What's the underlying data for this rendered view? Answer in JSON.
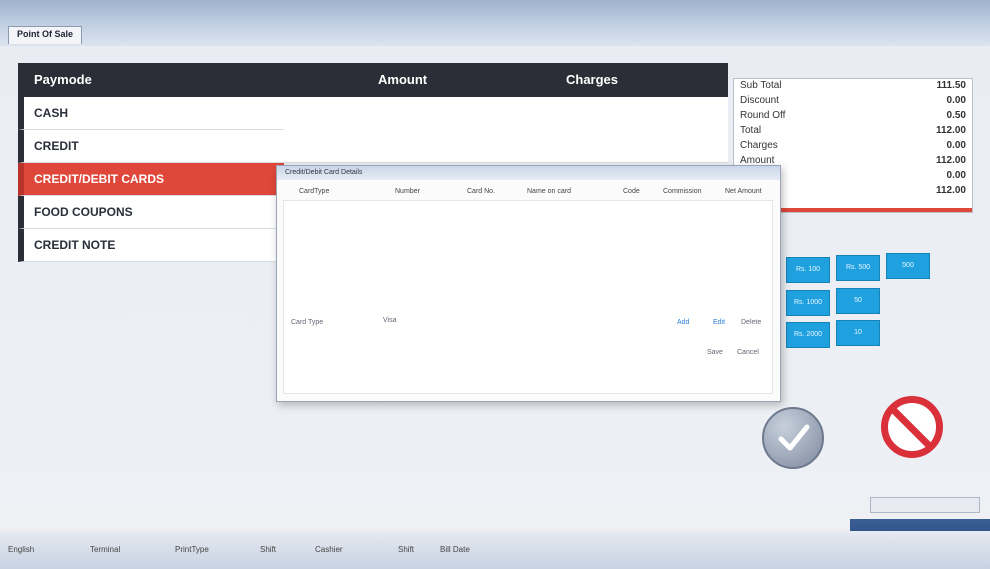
{
  "window": {
    "tab_label": "Point Of Sale"
  },
  "paymode": {
    "headers": {
      "paymode": "Paymode",
      "amount": "Amount",
      "charges": "Charges"
    },
    "rows": [
      "CASH",
      "CREDIT",
      "CREDIT/DEBIT CARDS",
      "FOOD COUPONS",
      "CREDIT NOTE"
    ],
    "active_index": 2
  },
  "totals": {
    "rows": [
      {
        "label": "Sub Total",
        "value": "111.50"
      },
      {
        "label": "Discount",
        "value": "0.00"
      },
      {
        "label": "Round Off",
        "value": "0.50"
      },
      {
        "label": "Total",
        "value": "112.00"
      },
      {
        "label": "Charges",
        "value": "0.00"
      },
      {
        "label": "Amount",
        "value": "112.00"
      },
      {
        "label": "",
        "value": "0.00"
      },
      {
        "label": "",
        "value": "112.00"
      }
    ]
  },
  "dialog": {
    "title": "Credit/Debit Card Details",
    "columns": [
      "CardType",
      "Number",
      "Card No.",
      "Name on card",
      "Code",
      "Commission",
      "Net Amount"
    ],
    "card_type_label": "Card Type",
    "card_type_value": "Visa",
    "buttons": [
      "Add",
      "Edit",
      "Delete"
    ],
    "footer_links": [
      "Save",
      "Cancel"
    ]
  },
  "quick_buttons": [
    "Rs. 100",
    "Rs. 500",
    "500",
    "Rs. 1000",
    "50",
    "Rs. 2000",
    "10"
  ],
  "status_bar": {
    "items": [
      "English",
      "Terminal",
      "PrintType",
      "Shift",
      "Cashier",
      "Shift",
      "Bill Date"
    ]
  },
  "colors": {
    "header_dark": "#2b2e37",
    "active_red": "#e0473b",
    "quick_blue": "#1fa1e0",
    "cancel_red": "#d9303a"
  }
}
